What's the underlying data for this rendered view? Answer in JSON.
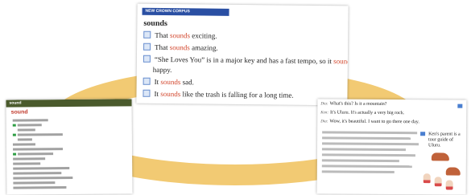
{
  "colors": {
    "ring": "#f0c15a",
    "header_blue": "#2a4fa3",
    "keyword_red": "#d2452b",
    "left_header": "#4a5a2c"
  },
  "top_panel": {
    "banner": "NEW CROWN CORPUS",
    "keyword": "sounds",
    "lines": [
      {
        "pre": "That ",
        "key": "sounds",
        "post": " exciting."
      },
      {
        "pre": "That ",
        "key": "sounds",
        "post": " amazing."
      },
      {
        "pre": "“She Loves You” is in a major key and has a fast tempo, so it ",
        "key": "sounds",
        "post": ""
      },
      {
        "pre": "happy.",
        "key": "",
        "post": ""
      },
      {
        "pre": "It ",
        "key": "sounds",
        "post": " sad."
      },
      {
        "pre": "It ",
        "key": "sounds",
        "post": " like the trash is falling for a long time."
      }
    ]
  },
  "left_panel": {
    "header": "sound",
    "keyword": "sound"
  },
  "right_panel": {
    "lines": [
      {
        "speaker": "Dia:",
        "text": "What's this?  Is it a mountain?"
      },
      {
        "speaker": "Ken:",
        "text": "It's Uluru.  It's actually a very big rock."
      },
      {
        "speaker": "Dia:",
        "text": "Wow, it's beautiful.  I want to go there one day."
      }
    ],
    "side_text": "Ken's parent is a tour guide of Uluru."
  }
}
